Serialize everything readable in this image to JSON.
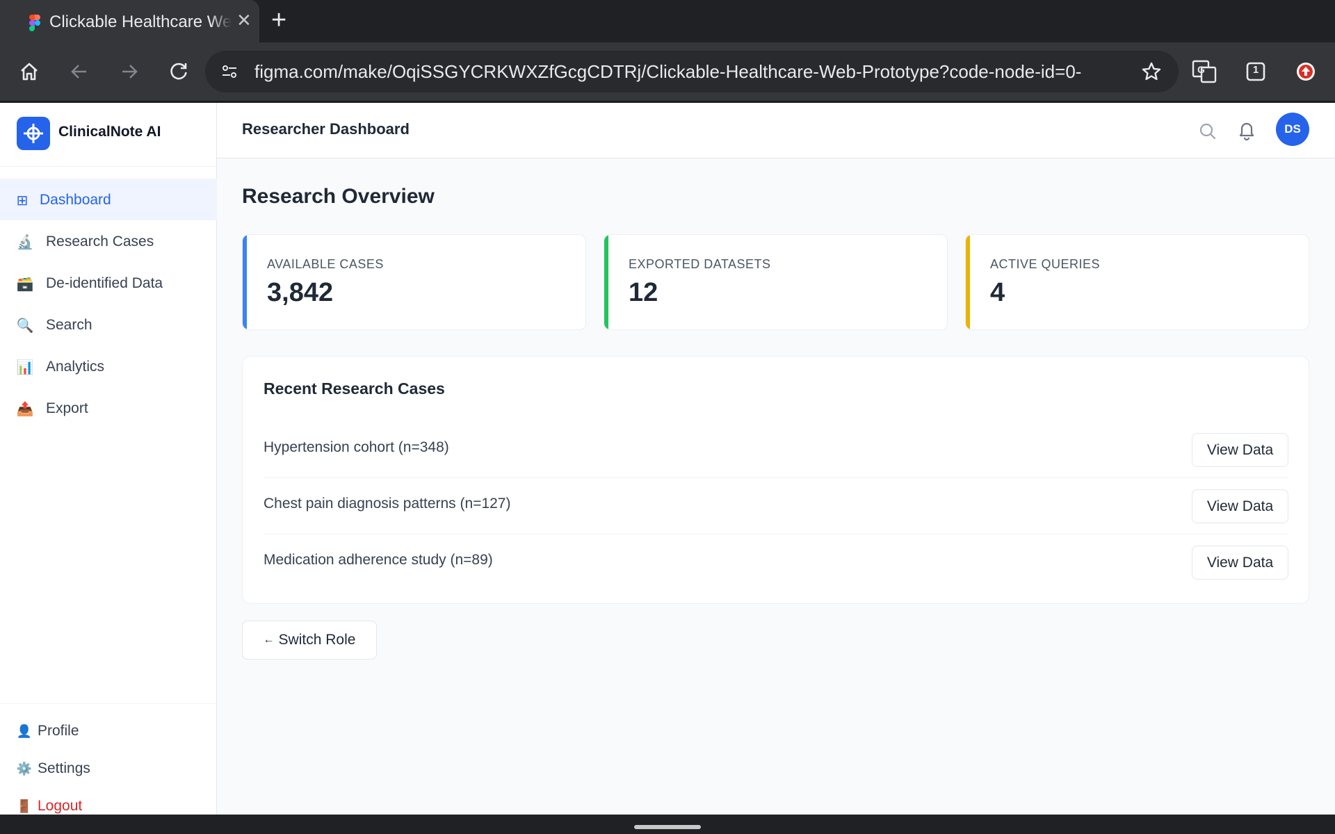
{
  "browser": {
    "tab_title": "Clickable Healthcare Web-Prototype",
    "tab_close": "✕",
    "new_tab": "+",
    "url": "figma.com/make/OqiSSGYCRKWXZfGcgCDTRj/Clickable-Healthcare-Web-Prototype?code-node-id=0-",
    "tab_count": "1",
    "icons": [
      "home-icon",
      "back-icon",
      "forward-icon",
      "reload-icon",
      "site-settings-icon",
      "star-icon",
      "translate-icon",
      "tab-switcher-icon",
      "update-icon"
    ]
  },
  "app": {
    "brand_name": "ClinicalNote AI",
    "brand_color": "#2563eb",
    "nav": [
      {
        "label": "Dashboard",
        "icon": "⊞",
        "icon_name": "grid-icon",
        "active": true
      },
      {
        "label": "Research Cases",
        "icon": "🔬",
        "icon_name": "microscope-icon",
        "active": false
      },
      {
        "label": "De-identified Data",
        "icon": "🗃️",
        "icon_name": "card-file-box-icon",
        "active": false
      },
      {
        "label": "Search",
        "icon": "🔍",
        "icon_name": "magnifier-icon",
        "active": false
      },
      {
        "label": "Analytics",
        "icon": "📊",
        "icon_name": "bar-chart-icon",
        "active": false
      },
      {
        "label": "Export",
        "icon": "📤",
        "icon_name": "outbox-tray-icon",
        "active": false
      }
    ],
    "bottom_nav": [
      {
        "label": "Profile",
        "icon": "👤",
        "icon_name": "user-icon"
      },
      {
        "label": "Settings",
        "icon": "⚙️",
        "icon_name": "gear-icon"
      },
      {
        "label": "Logout",
        "icon": "🚪",
        "icon_name": "door-icon"
      }
    ],
    "header": {
      "title": "Researcher Dashboard",
      "avatar_initials": "DS"
    },
    "main": {
      "page_title": "Research Overview",
      "stats": [
        {
          "label": "AVAILABLE CASES",
          "value": "3,842",
          "accent": "#3b82f6"
        },
        {
          "label": "EXPORTED DATASETS",
          "value": "12",
          "accent": "#22c55e"
        },
        {
          "label": "ACTIVE QUERIES",
          "value": "4",
          "accent": "#eab308"
        }
      ],
      "recent": {
        "title": "Recent Research Cases",
        "button_label": "View Data",
        "rows": [
          {
            "text": "Hypertension cohort (n=348)"
          },
          {
            "text": "Chest pain diagnosis patterns (n=127)"
          },
          {
            "text": "Medication adherence study (n=89)"
          }
        ]
      },
      "switch_role": {
        "arrow": "←",
        "label": "Switch Role"
      }
    }
  }
}
